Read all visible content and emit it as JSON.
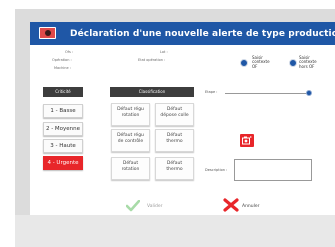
{
  "window": {
    "title": "Déclaration d'une nouvelle alerte de type production"
  },
  "header_info": {
    "left_lines": [
      "Ofs :",
      "Opération :",
      "Machine :"
    ],
    "center_lines": [
      "Lot :",
      "Etat opération :"
    ]
  },
  "radios": [
    {
      "label": "Saisir\ncontexte\nOF"
    },
    {
      "label": "Saisir\ncontexte\nhors OF"
    }
  ],
  "columns": {
    "criticity_header": "Criticité",
    "classification_header": "Classification"
  },
  "priorities": [
    {
      "label": "1 - Basse",
      "selected": false
    },
    {
      "label": "2 - Moyenne",
      "selected": false
    },
    {
      "label": "3 - Haute",
      "selected": false
    },
    {
      "label": "4 - Urgente",
      "selected": true
    }
  ],
  "classifications": [
    [
      "Défaut régu\nrotation",
      "Défaut\ndépose colle"
    ],
    [
      "Défaut régu\nde contrôle",
      "Défaut\nthermo"
    ],
    [
      "Défaut\nrotation",
      "Défaut\nthermo"
    ]
  ],
  "form": {
    "etape_label": "Etape :",
    "description_label": "Description :",
    "description_value": ""
  },
  "actions": {
    "validate_label": "Valider",
    "cancel_label": "Annuler"
  },
  "colors": {
    "title_bar": "#1f57a6",
    "urgent": "#e8262a",
    "header_dark": "#3d3d3d"
  }
}
